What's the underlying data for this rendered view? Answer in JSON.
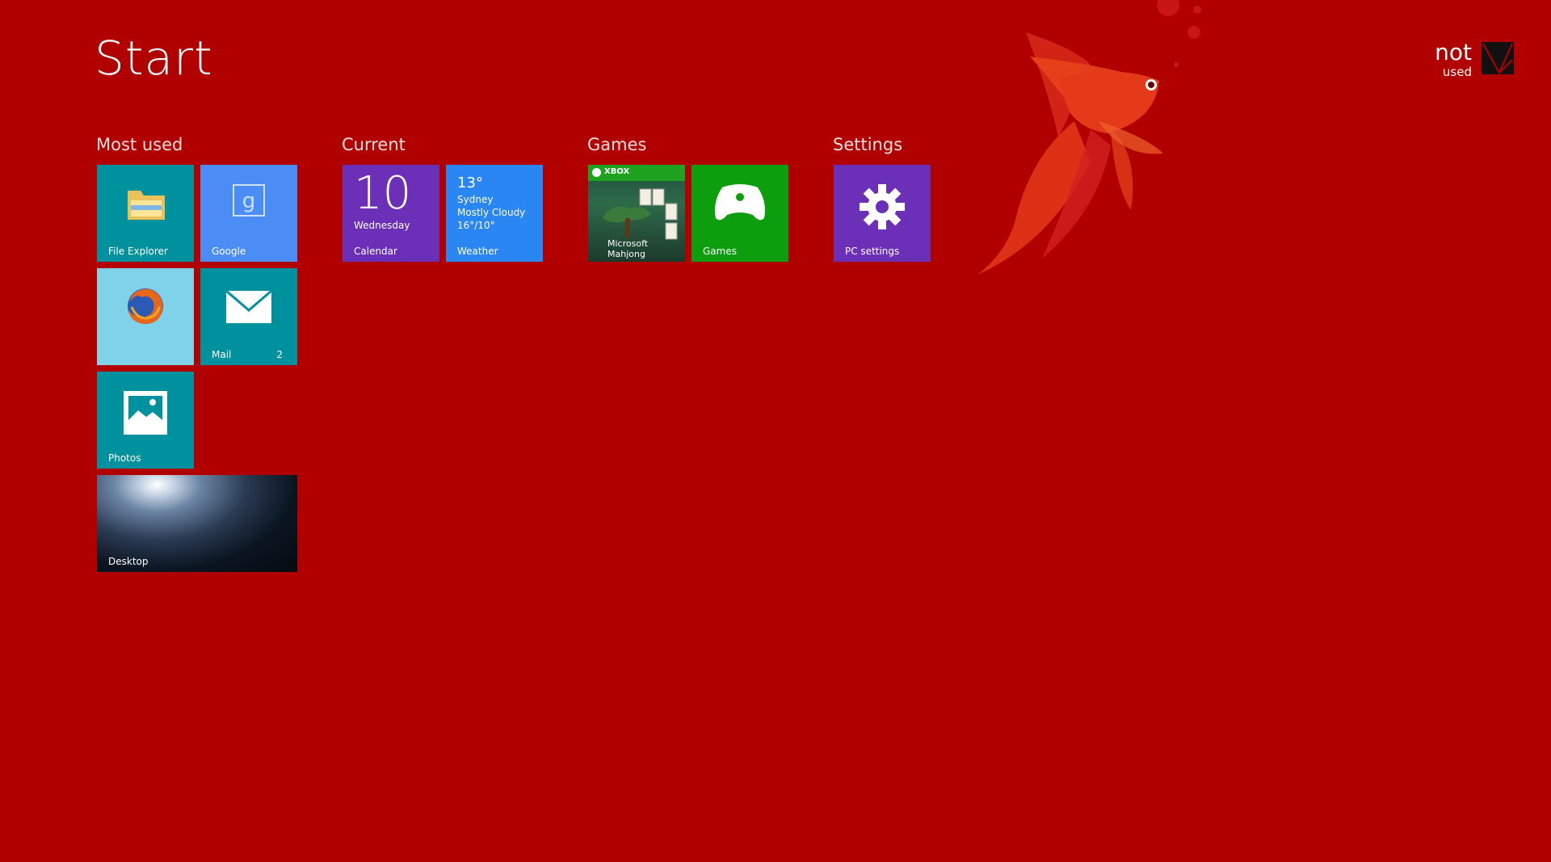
{
  "start": {
    "title": "Start"
  },
  "user": {
    "name": "not",
    "subtitle": "used"
  },
  "groups": [
    {
      "name": "Most used"
    },
    {
      "name": "Current"
    },
    {
      "name": "Games"
    },
    {
      "name": "Settings"
    }
  ],
  "tiles": {
    "file_explorer": {
      "label": "File Explorer",
      "color": "#00919e"
    },
    "google": {
      "label": "Google",
      "color": "#4c8df5"
    },
    "firefox": {
      "label": "",
      "color": "#7fd2e8"
    },
    "mail": {
      "label": "Mail",
      "badge": "2",
      "color": "#00919e"
    },
    "photos": {
      "label": "Photos",
      "color": "#00919e"
    },
    "desktop": {
      "label": "Desktop"
    },
    "calendar": {
      "label": "Calendar",
      "day": "10",
      "weekday": "Wednesday",
      "color": "#6b2fb8"
    },
    "weather": {
      "label": "Weather",
      "temp": "13°",
      "city": "Sydney",
      "condition": "Mostly Cloudy",
      "range": "16°/10°",
      "color": "#2a86f2"
    },
    "mahjong": {
      "brand": "XBOX",
      "label_line1": "Microsoft",
      "label_line2": "Mahjong"
    },
    "games": {
      "label": "Games",
      "color": "#0d9e0d"
    },
    "pc_settings": {
      "label": "PC settings",
      "color": "#6b2fb8"
    }
  }
}
